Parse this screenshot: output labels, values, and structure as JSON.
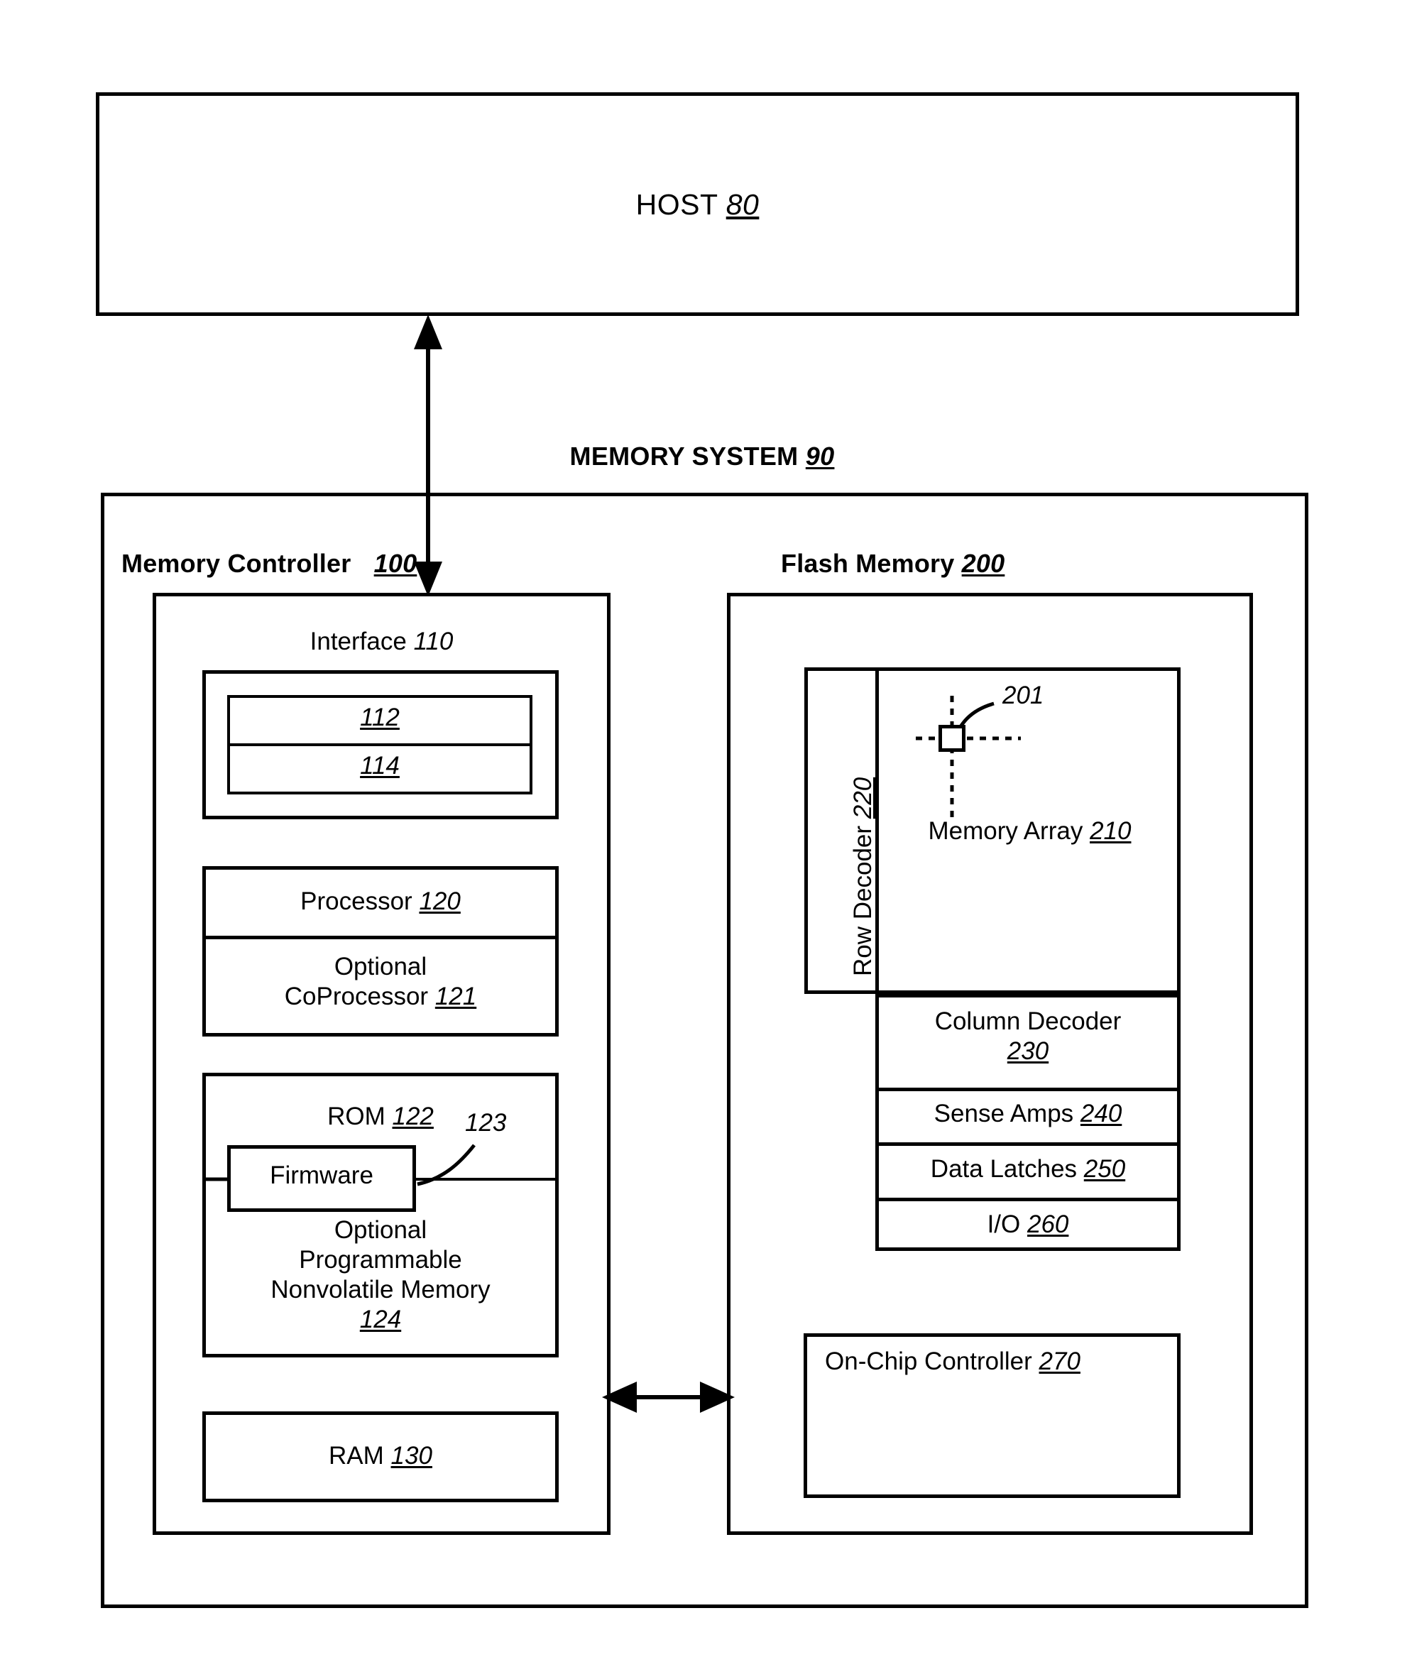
{
  "figure": {
    "host": {
      "label": "HOST",
      "ref": "80"
    },
    "memory_system": {
      "label": "MEMORY SYSTEM",
      "ref": "90"
    },
    "memory_controller": {
      "label": "Memory Controller",
      "ref": "100"
    },
    "flash_memory": {
      "label": "Flash Memory",
      "ref": "200"
    },
    "controller_blocks": {
      "interface": {
        "label": "Interface",
        "ref": "110"
      },
      "interface_sub": [
        {
          "label": "",
          "ref": "112"
        },
        {
          "label": "",
          "ref": "114"
        }
      ],
      "processor": {
        "label": "Processor",
        "ref": "120"
      },
      "coprocessor": {
        "label": "Optional\nCoProcessor",
        "line1": "Optional",
        "line2": "CoProcessor",
        "ref": "121"
      },
      "rom": {
        "label": "ROM",
        "ref": "122"
      },
      "firmware": {
        "label": "Firmware",
        "ref": "123"
      },
      "nvm": {
        "line1": "Optional",
        "line2": "Programmable",
        "line3": "Nonvolatile Memory",
        "ref": "124"
      },
      "ram": {
        "label": "RAM",
        "ref": "130"
      }
    },
    "flash_blocks": {
      "row_decoder": {
        "label": "Row Decoder",
        "ref": "220"
      },
      "memory_array": {
        "label": "Memory Array",
        "ref": "210"
      },
      "memory_cell": {
        "ref": "201"
      },
      "column_decoder": {
        "label": "Column Decoder",
        "ref": "230"
      },
      "sense_amps": {
        "label": "Sense Amps",
        "ref": "240"
      },
      "data_latches": {
        "label": "Data Latches",
        "ref": "250"
      },
      "io": {
        "label": "I/O",
        "ref": "260"
      },
      "on_chip_controller": {
        "label": "On-Chip Controller",
        "ref": "270"
      }
    },
    "colors": {
      "line": "#000000",
      "background": "#ffffff"
    }
  }
}
